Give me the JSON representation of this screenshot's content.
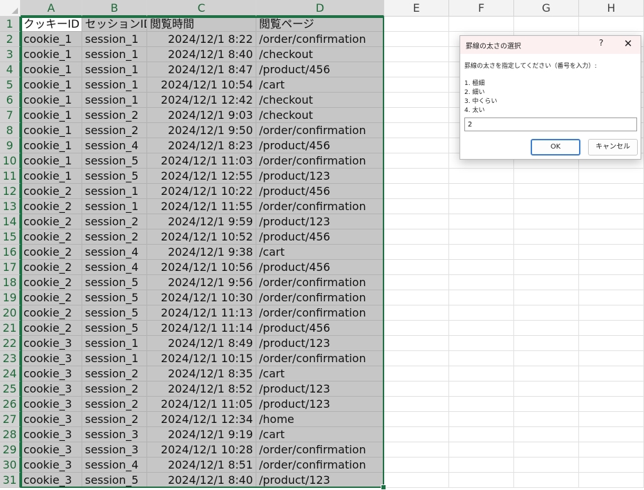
{
  "columns": [
    "A",
    "B",
    "C",
    "D",
    "E",
    "F",
    "G",
    "H"
  ],
  "rows": [
    [
      "クッキーID",
      "セッションID",
      "閲覧時間",
      "閲覧ページ"
    ],
    [
      "cookie_1",
      "session_1",
      "2024/12/1 8:22",
      "/order/confirmation"
    ],
    [
      "cookie_1",
      "session_1",
      "2024/12/1 8:40",
      "/checkout"
    ],
    [
      "cookie_1",
      "session_1",
      "2024/12/1 8:47",
      "/product/456"
    ],
    [
      "cookie_1",
      "session_1",
      "2024/12/1 10:54",
      "/cart"
    ],
    [
      "cookie_1",
      "session_1",
      "2024/12/1 12:42",
      "/checkout"
    ],
    [
      "cookie_1",
      "session_2",
      "2024/12/1 9:03",
      "/checkout"
    ],
    [
      "cookie_1",
      "session_2",
      "2024/12/1 9:50",
      "/order/confirmation"
    ],
    [
      "cookie_1",
      "session_4",
      "2024/12/1 8:23",
      "/product/456"
    ],
    [
      "cookie_1",
      "session_5",
      "2024/12/1 11:03",
      "/order/confirmation"
    ],
    [
      "cookie_1",
      "session_5",
      "2024/12/1 12:55",
      "/product/123"
    ],
    [
      "cookie_2",
      "session_1",
      "2024/12/1 10:22",
      "/product/456"
    ],
    [
      "cookie_2",
      "session_1",
      "2024/12/1 11:55",
      "/order/confirmation"
    ],
    [
      "cookie_2",
      "session_2",
      "2024/12/1 9:59",
      "/product/123"
    ],
    [
      "cookie_2",
      "session_2",
      "2024/12/1 10:52",
      "/product/456"
    ],
    [
      "cookie_2",
      "session_4",
      "2024/12/1 9:38",
      "/cart"
    ],
    [
      "cookie_2",
      "session_4",
      "2024/12/1 10:56",
      "/product/456"
    ],
    [
      "cookie_2",
      "session_5",
      "2024/12/1 9:56",
      "/order/confirmation"
    ],
    [
      "cookie_2",
      "session_5",
      "2024/12/1 10:30",
      "/order/confirmation"
    ],
    [
      "cookie_2",
      "session_5",
      "2024/12/1 11:13",
      "/order/confirmation"
    ],
    [
      "cookie_2",
      "session_5",
      "2024/12/1 11:14",
      "/product/456"
    ],
    [
      "cookie_3",
      "session_1",
      "2024/12/1 8:49",
      "/product/123"
    ],
    [
      "cookie_3",
      "session_1",
      "2024/12/1 10:15",
      "/order/confirmation"
    ],
    [
      "cookie_3",
      "session_2",
      "2024/12/1 8:35",
      "/cart"
    ],
    [
      "cookie_3",
      "session_2",
      "2024/12/1 8:52",
      "/product/123"
    ],
    [
      "cookie_3",
      "session_2",
      "2024/12/1 11:05",
      "/product/123"
    ],
    [
      "cookie_3",
      "session_2",
      "2024/12/1 12:34",
      "/home"
    ],
    [
      "cookie_3",
      "session_3",
      "2024/12/1 9:19",
      "/cart"
    ],
    [
      "cookie_3",
      "session_3",
      "2024/12/1 10:28",
      "/order/confirmation"
    ],
    [
      "cookie_3",
      "session_4",
      "2024/12/1 8:51",
      "/order/confirmation"
    ],
    [
      "cookie_3",
      "session_5",
      "2024/12/1 8:40",
      "/product/123"
    ]
  ],
  "selected_columns": [
    "A",
    "B",
    "C",
    "D"
  ],
  "dialog": {
    "title": "罫線の太さの選択",
    "help_label": "?",
    "close_label": "✕",
    "prompt": "罫線の太さを指定してください（番号を入力）:",
    "options": [
      "1. 極細",
      "2. 細い",
      "3. 中くらい",
      "4. 太い"
    ],
    "input_value": "2",
    "ok_label": "OK",
    "cancel_label": "キャンセル"
  },
  "colors": {
    "selection_border": "#1e7145",
    "selected_fill": "#c6c6c6",
    "dialog_title_bg": "#fdf0f1",
    "ok_border": "#3b7ed6"
  }
}
